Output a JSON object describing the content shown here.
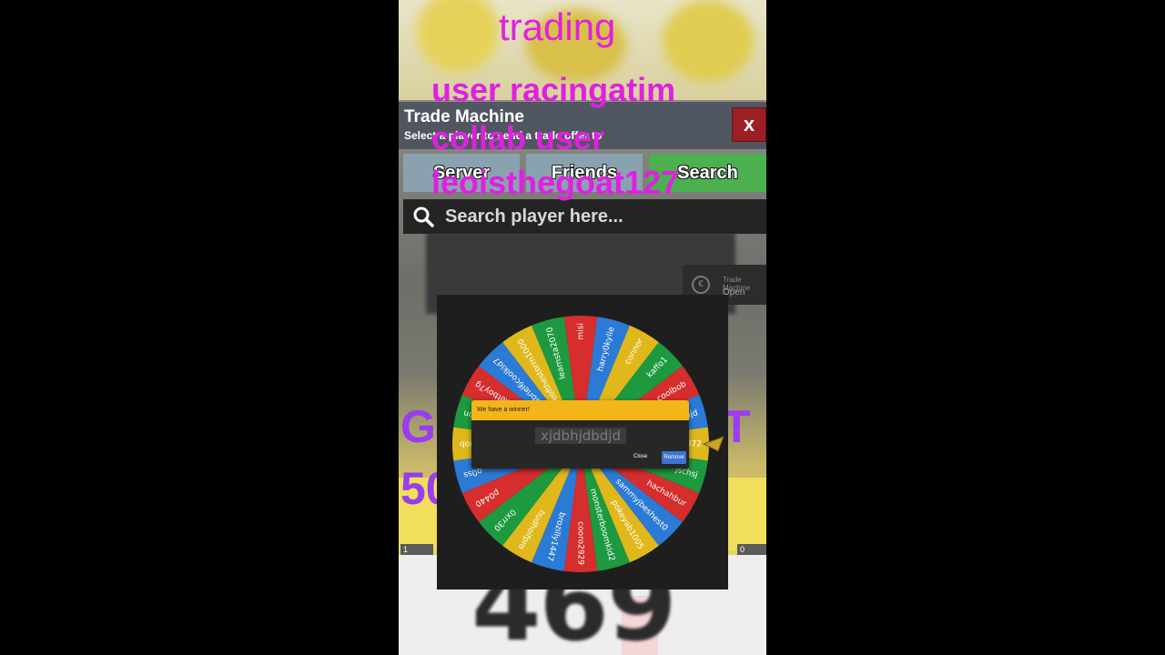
{
  "overlay": {
    "line1": "trading",
    "line2": "user racingatim",
    "line3": "collab user",
    "line4": "leoisthegoat127"
  },
  "trade_machine": {
    "title": "Trade Machine",
    "subtitle": "Select a player to send a trade offer to",
    "close_label": "x",
    "tabs": [
      {
        "label": "Server",
        "color": "#8aa2b0"
      },
      {
        "label": "Friends",
        "color": "#8aa2b0"
      },
      {
        "label": "Search",
        "color": "#4caf50"
      }
    ],
    "search_placeholder": "Search player here..."
  },
  "notification": {
    "title": "Trade Machine",
    "status": "Open",
    "icon": "coin-icon"
  },
  "background": {
    "left_text_1": "G",
    "left_text_2": "50",
    "right_text": "T",
    "big_number": "469",
    "inventory_slots": [
      "1",
      "0"
    ]
  },
  "wheel": {
    "colors": [
      "#d62d2d",
      "#2b7bd6",
      "#e0b81c",
      "#1d9a3f"
    ],
    "entries": [
      "misi",
      "harry0kylie",
      "connor",
      "kaffo1",
      "coolbob",
      "djdjd",
      "misin4072",
      "jschsj",
      "hachahbur",
      "sammyjbeshest0",
      "pokeyab1005",
      "monsterboomkid2",
      "cooro2929",
      "brozilly1447",
      "hudhoifpro",
      "0xrr30",
      "p0440",
      "g0ss",
      "hrosenoob",
      "brion",
      "rocketboy7g",
      "gabriel6coolkid7",
      "eyeofthestorm1000",
      "leamsta2070"
    ],
    "winner_header": "We have a winner!",
    "winner_name": "xjdbhjdbdjd",
    "close_label": "Close",
    "remove_label": "Remove"
  }
}
